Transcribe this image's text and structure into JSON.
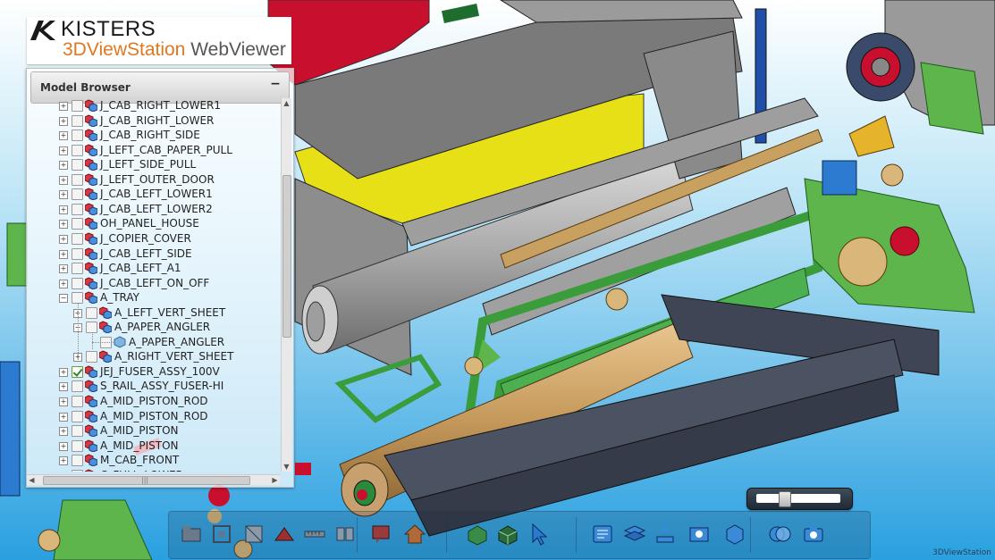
{
  "logo": {
    "brand": "KISTERS",
    "product_main": "3DViewStation",
    "product_sub": "WebViewer"
  },
  "model_browser": {
    "title": "Model Browser",
    "collapse_glyph": "−",
    "items": [
      {
        "label": "J_CAB_RIGHT_LOWER1",
        "level": 0,
        "checked": false
      },
      {
        "label": "J_CAB_RIGHT_LOWER",
        "level": 0,
        "checked": false
      },
      {
        "label": "J_CAB_RIGHT_SIDE",
        "level": 0,
        "checked": false
      },
      {
        "label": "J_LEFT_CAB_PAPER_PULL",
        "level": 0,
        "checked": false
      },
      {
        "label": "J_LEFT_SIDE_PULL",
        "level": 0,
        "checked": false
      },
      {
        "label": "J_LEFT_OUTER_DOOR",
        "level": 0,
        "checked": false
      },
      {
        "label": "J_CAB_LEFT_LOWER1",
        "level": 0,
        "checked": false
      },
      {
        "label": "J_CAB_LEFT_LOWER2",
        "level": 0,
        "checked": false
      },
      {
        "label": "OH_PANEL_HOUSE",
        "level": 0,
        "checked": false
      },
      {
        "label": "J_COPIER_COVER",
        "level": 0,
        "checked": false
      },
      {
        "label": "J_CAB_LEFT_SIDE",
        "level": 0,
        "checked": false
      },
      {
        "label": "J_CAB_LEFT_A1",
        "level": 0,
        "checked": false
      },
      {
        "label": "J_CAB_LEFT_ON_OFF",
        "level": 0,
        "checked": false
      },
      {
        "label": "A_TRAY",
        "level": 0,
        "checked": false
      },
      {
        "label": "A_LEFT_VERT_SHEET",
        "level": 1,
        "checked": false
      },
      {
        "label": "A_PAPER_ANGLER",
        "level": 1,
        "checked": false
      },
      {
        "label": "A_PAPER_ANGLER",
        "level": 2,
        "checked": false
      },
      {
        "label": "A_RIGHT_VERT_SHEET",
        "level": 1,
        "checked": false
      },
      {
        "label": "JEJ_FUSER_ASSY_100V",
        "level": 0,
        "checked": true
      },
      {
        "label": "S_RAIL_ASSY_FUSER-HI",
        "level": 0,
        "checked": false
      },
      {
        "label": "A_MID_PISTON_ROD",
        "level": 0,
        "checked": false
      },
      {
        "label": "A_MID_PISTON_ROD",
        "level": 0,
        "checked": false
      },
      {
        "label": "A_MID_PISTON",
        "level": 0,
        "checked": false
      },
      {
        "label": "A_MID_PISTON",
        "level": 0,
        "checked": false
      },
      {
        "label": "M_CAB_FRONT",
        "level": 0,
        "checked": false
      },
      {
        "label": "C_FULL_LOWER",
        "level": 0,
        "checked": false
      }
    ],
    "scroll_grip": "|||"
  },
  "slider": {
    "value": 0.3
  },
  "toolbar": {
    "buttons": [
      {
        "name": "open-icon"
      },
      {
        "name": "fit-view-icon"
      },
      {
        "name": "box-select-icon"
      },
      {
        "name": "section-icon"
      },
      {
        "name": "measure-icon"
      },
      {
        "name": "explode-icon"
      },
      {
        "name": "markup-icon"
      },
      {
        "name": "home-icon"
      },
      {
        "name": "shaded-icon"
      },
      {
        "name": "wireframe-icon"
      },
      {
        "name": "select-icon"
      },
      {
        "name": "properties-icon"
      },
      {
        "name": "layers-icon"
      },
      {
        "name": "annotations-icon"
      },
      {
        "name": "screenshot-icon"
      },
      {
        "name": "views-icon"
      },
      {
        "name": "transparency-icon"
      },
      {
        "name": "camera-icon"
      }
    ]
  },
  "watermark": "3DViewStation",
  "colors": {
    "background_top": "#ffffff",
    "background_bottom": "#2aa0e0",
    "logo_orange": "#e07820"
  }
}
